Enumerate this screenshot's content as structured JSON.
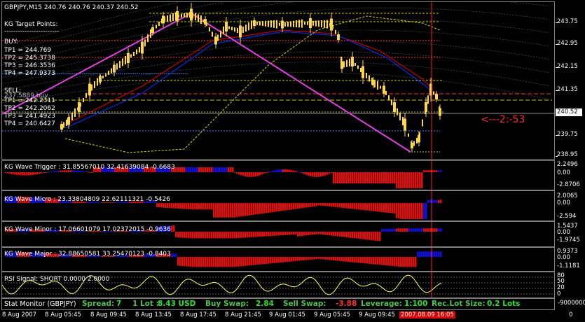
{
  "main_chart": {
    "title": "GBPJPY,M15  240.76 240.76 240.37 240.52",
    "target_title": "KG Target Points:",
    "target_underline": "------------------------",
    "buy_title": "BUY:",
    "buy_tps": [
      "TP1 = 244.769",
      "TP2 = 245.3738",
      "TP3 = 246.3536",
      "TP4 = 247.9373"
    ],
    "sell_title": "SELL:",
    "sell_tps": [
      "TP1 = 242.2311",
      "TP2 = 242.2062",
      "TP3 = 241.4923",
      "TP4 = 240.6427"
    ],
    "sell_overlay": "237.5889 buy",
    "countdown": "<---2:-53",
    "countdown_color": "#ff2a2a",
    "current_price": "240.52",
    "price_ticks": [
      "243.75",
      "242.95",
      "242.15",
      "241.35",
      "239.75",
      "238.95"
    ]
  },
  "indicators": [
    {
      "name": "KG Wave Trigger : 31.85567010 32.41639084 -0.6683",
      "ticks": [
        "2.2496",
        "0.00",
        "-2.8706"
      ]
    },
    {
      "name": "KG Wave Micro : 23.33804809 22.62111321 -0.5426",
      "ticks": [
        "2.0065",
        "0.00",
        "-2.594"
      ]
    },
    {
      "name": "KG Wave Minor : 17.06601079 17.02372015 -0.9636",
      "ticks": [
        "1.5437",
        "0.00",
        "-1.9745"
      ]
    },
    {
      "name": "KG Wave Major : 32.88650581 33.25470123 -0.8403",
      "ticks": [
        "0.9373",
        "0.00",
        "-1.1181"
      ]
    }
  ],
  "rsi": {
    "name": "RSI Signal: SHORT 0.0000 2.0000",
    "ticks": [
      "80",
      "50",
      "20",
      "0"
    ]
  },
  "status_bar": {
    "title": "Stat Monitor (GBPJPY)",
    "spread_label": "Spread:",
    "spread_value": "7",
    "lot_label": "1 Lot :",
    "lot_value": "8.43 USD",
    "buy_swap_label": "Buy Swap:",
    "buy_swap_value": "2.84",
    "sell_swap_label": "Sell Swap:",
    "sell_swap_value": "-3.88",
    "leverage_label": "Leverage:",
    "leverage_value": "1:100",
    "rec_lot_label": "Rec.Lot Size:",
    "rec_lot_value": "0.2 Lots",
    "right_value": "-9000000"
  },
  "time_axis": {
    "labels": [
      "8 Aug 2007",
      "8 Aug 05:45",
      "8 Aug 09:45",
      "8 Aug 13:45",
      "8 Aug 17:45",
      "8 Aug 21:45",
      "9 Aug 01:45",
      "9 Aug 05:45",
      "9 Aug 09:45"
    ],
    "highlight": "2007.08.09 16:05",
    "corner": "0"
  },
  "colors": {
    "candle": "#ffd84a",
    "magenta": "#e040e0",
    "buy_color": "#4080ff",
    "sell_color": "#c8c800",
    "red_level": "#ff3030",
    "positive_bar": "#1010e0",
    "negative_bar": "#e01010",
    "spread": "#4fc04f",
    "value_green": "#30e030",
    "red_value": "#ff3030"
  }
}
